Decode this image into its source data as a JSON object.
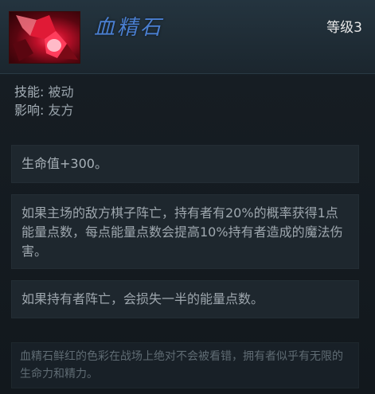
{
  "item": {
    "name": "血精石",
    "level": "等级3",
    "icon": "bloodstone-icon"
  },
  "meta": {
    "skill_label": "技能:",
    "skill_value": "被动",
    "affect_label": "影响:",
    "affect_value": "友方"
  },
  "effects": {
    "stat": "生命值+300。",
    "passive": "如果主场的敌方棋子阵亡，持有者有20%的概率获得1点能量点数，每点能量点数会提高10%持有者造成的魔法伤害。",
    "death": "如果持有者阵亡，会损失一半的能量点数。"
  },
  "lore": "血精石鲜红的色彩在战场上绝对不会被看错，拥有者似乎有无限的生命力和精力。",
  "colors": {
    "name": "#4a7fd1",
    "background": "#141a20",
    "icon_red": "#c0102a"
  }
}
